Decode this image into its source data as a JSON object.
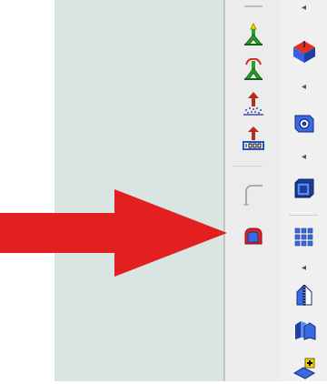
{
  "left_toolbar": {
    "tools": [
      {
        "icon": "constraint-yellow-green-icon"
      },
      {
        "icon": "constraint-rotate-icon"
      },
      {
        "icon": "pressure-load-icon"
      },
      {
        "icon": "pressure-load-value-icon"
      },
      {
        "icon": "fillet-curve-icon"
      },
      {
        "icon": "highlighted-fillet-icon"
      }
    ]
  },
  "right_toolbar": {
    "tools": [
      {
        "icon": "solid-extrude-icon"
      },
      {
        "icon": "hole-feature-icon"
      },
      {
        "icon": "shell-feature-icon"
      },
      {
        "icon": "pattern-grid-icon"
      },
      {
        "icon": "mirror-feature-icon"
      },
      {
        "icon": "draft-feature-icon"
      },
      {
        "icon": "add-feature-icon"
      }
    ]
  },
  "colors": {
    "arrow": "#e32020",
    "canvas": "#d9e5e3"
  }
}
